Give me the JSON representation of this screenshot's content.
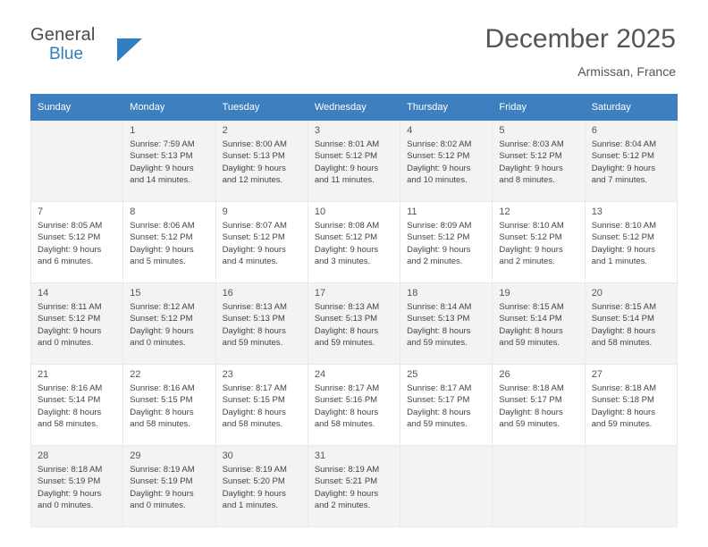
{
  "brand": {
    "name_top": "General",
    "name_bottom": "Blue",
    "accent_color": "#2f7fc1"
  },
  "header": {
    "month_title": "December 2025",
    "location": "Armissan, France"
  },
  "calendar": {
    "weekday_headers": [
      "Sunday",
      "Monday",
      "Tuesday",
      "Wednesday",
      "Thursday",
      "Friday",
      "Saturday"
    ],
    "header_bg": "#3d7fbf",
    "weeks": [
      [
        {
          "day": "",
          "lines": []
        },
        {
          "day": "1",
          "lines": [
            "Sunrise: 7:59 AM",
            "Sunset: 5:13 PM",
            "Daylight: 9 hours",
            "and 14 minutes."
          ]
        },
        {
          "day": "2",
          "lines": [
            "Sunrise: 8:00 AM",
            "Sunset: 5:13 PM",
            "Daylight: 9 hours",
            "and 12 minutes."
          ]
        },
        {
          "day": "3",
          "lines": [
            "Sunrise: 8:01 AM",
            "Sunset: 5:12 PM",
            "Daylight: 9 hours",
            "and 11 minutes."
          ]
        },
        {
          "day": "4",
          "lines": [
            "Sunrise: 8:02 AM",
            "Sunset: 5:12 PM",
            "Daylight: 9 hours",
            "and 10 minutes."
          ]
        },
        {
          "day": "5",
          "lines": [
            "Sunrise: 8:03 AM",
            "Sunset: 5:12 PM",
            "Daylight: 9 hours",
            "and 8 minutes."
          ]
        },
        {
          "day": "6",
          "lines": [
            "Sunrise: 8:04 AM",
            "Sunset: 5:12 PM",
            "Daylight: 9 hours",
            "and 7 minutes."
          ]
        }
      ],
      [
        {
          "day": "7",
          "lines": [
            "Sunrise: 8:05 AM",
            "Sunset: 5:12 PM",
            "Daylight: 9 hours",
            "and 6 minutes."
          ]
        },
        {
          "day": "8",
          "lines": [
            "Sunrise: 8:06 AM",
            "Sunset: 5:12 PM",
            "Daylight: 9 hours",
            "and 5 minutes."
          ]
        },
        {
          "day": "9",
          "lines": [
            "Sunrise: 8:07 AM",
            "Sunset: 5:12 PM",
            "Daylight: 9 hours",
            "and 4 minutes."
          ]
        },
        {
          "day": "10",
          "lines": [
            "Sunrise: 8:08 AM",
            "Sunset: 5:12 PM",
            "Daylight: 9 hours",
            "and 3 minutes."
          ]
        },
        {
          "day": "11",
          "lines": [
            "Sunrise: 8:09 AM",
            "Sunset: 5:12 PM",
            "Daylight: 9 hours",
            "and 2 minutes."
          ]
        },
        {
          "day": "12",
          "lines": [
            "Sunrise: 8:10 AM",
            "Sunset: 5:12 PM",
            "Daylight: 9 hours",
            "and 2 minutes."
          ]
        },
        {
          "day": "13",
          "lines": [
            "Sunrise: 8:10 AM",
            "Sunset: 5:12 PM",
            "Daylight: 9 hours",
            "and 1 minutes."
          ]
        }
      ],
      [
        {
          "day": "14",
          "lines": [
            "Sunrise: 8:11 AM",
            "Sunset: 5:12 PM",
            "Daylight: 9 hours",
            "and 0 minutes."
          ]
        },
        {
          "day": "15",
          "lines": [
            "Sunrise: 8:12 AM",
            "Sunset: 5:12 PM",
            "Daylight: 9 hours",
            "and 0 minutes."
          ]
        },
        {
          "day": "16",
          "lines": [
            "Sunrise: 8:13 AM",
            "Sunset: 5:13 PM",
            "Daylight: 8 hours",
            "and 59 minutes."
          ]
        },
        {
          "day": "17",
          "lines": [
            "Sunrise: 8:13 AM",
            "Sunset: 5:13 PM",
            "Daylight: 8 hours",
            "and 59 minutes."
          ]
        },
        {
          "day": "18",
          "lines": [
            "Sunrise: 8:14 AM",
            "Sunset: 5:13 PM",
            "Daylight: 8 hours",
            "and 59 minutes."
          ]
        },
        {
          "day": "19",
          "lines": [
            "Sunrise: 8:15 AM",
            "Sunset: 5:14 PM",
            "Daylight: 8 hours",
            "and 59 minutes."
          ]
        },
        {
          "day": "20",
          "lines": [
            "Sunrise: 8:15 AM",
            "Sunset: 5:14 PM",
            "Daylight: 8 hours",
            "and 58 minutes."
          ]
        }
      ],
      [
        {
          "day": "21",
          "lines": [
            "Sunrise: 8:16 AM",
            "Sunset: 5:14 PM",
            "Daylight: 8 hours",
            "and 58 minutes."
          ]
        },
        {
          "day": "22",
          "lines": [
            "Sunrise: 8:16 AM",
            "Sunset: 5:15 PM",
            "Daylight: 8 hours",
            "and 58 minutes."
          ]
        },
        {
          "day": "23",
          "lines": [
            "Sunrise: 8:17 AM",
            "Sunset: 5:15 PM",
            "Daylight: 8 hours",
            "and 58 minutes."
          ]
        },
        {
          "day": "24",
          "lines": [
            "Sunrise: 8:17 AM",
            "Sunset: 5:16 PM",
            "Daylight: 8 hours",
            "and 58 minutes."
          ]
        },
        {
          "day": "25",
          "lines": [
            "Sunrise: 8:17 AM",
            "Sunset: 5:17 PM",
            "Daylight: 8 hours",
            "and 59 minutes."
          ]
        },
        {
          "day": "26",
          "lines": [
            "Sunrise: 8:18 AM",
            "Sunset: 5:17 PM",
            "Daylight: 8 hours",
            "and 59 minutes."
          ]
        },
        {
          "day": "27",
          "lines": [
            "Sunrise: 8:18 AM",
            "Sunset: 5:18 PM",
            "Daylight: 8 hours",
            "and 59 minutes."
          ]
        }
      ],
      [
        {
          "day": "28",
          "lines": [
            "Sunrise: 8:18 AM",
            "Sunset: 5:19 PM",
            "Daylight: 9 hours",
            "and 0 minutes."
          ]
        },
        {
          "day": "29",
          "lines": [
            "Sunrise: 8:19 AM",
            "Sunset: 5:19 PM",
            "Daylight: 9 hours",
            "and 0 minutes."
          ]
        },
        {
          "day": "30",
          "lines": [
            "Sunrise: 8:19 AM",
            "Sunset: 5:20 PM",
            "Daylight: 9 hours",
            "and 1 minutes."
          ]
        },
        {
          "day": "31",
          "lines": [
            "Sunrise: 8:19 AM",
            "Sunset: 5:21 PM",
            "Daylight: 9 hours",
            "and 2 minutes."
          ]
        },
        {
          "day": "",
          "lines": []
        },
        {
          "day": "",
          "lines": []
        },
        {
          "day": "",
          "lines": []
        }
      ]
    ]
  }
}
